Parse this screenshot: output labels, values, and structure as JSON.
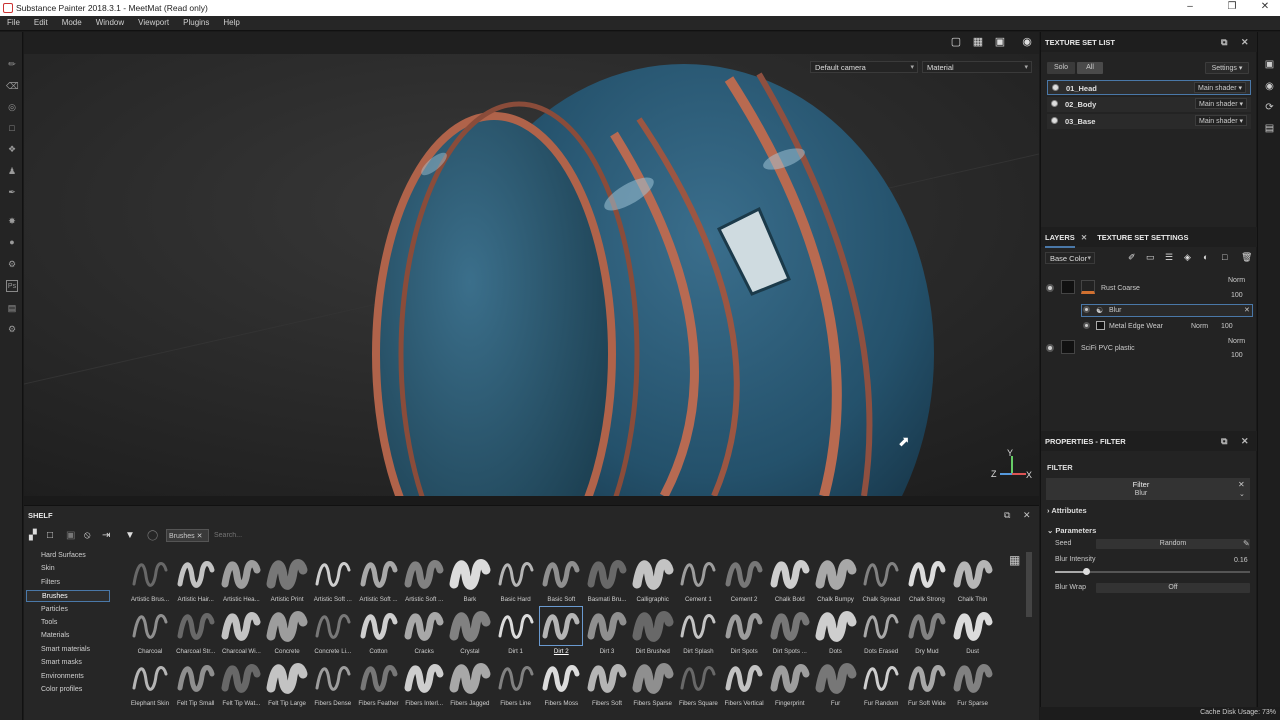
{
  "app": {
    "title": "Substance Painter 2018.3.1 - MeetMat (Read only)"
  },
  "menu": [
    "File",
    "Edit",
    "Mode",
    "Window",
    "Viewport",
    "Plugins",
    "Help"
  ],
  "viewport": {
    "camera": "Default camera",
    "mode": "Material",
    "gizmo": {
      "x": "X",
      "y": "Y",
      "z": "Z"
    }
  },
  "texture_set_list": {
    "title": "TEXTURE SET LIST",
    "solo": "Solo",
    "all": "All",
    "settings": "Settings",
    "sets": [
      {
        "name": "01_Head",
        "shader": "Main shader"
      },
      {
        "name": "02_Body",
        "shader": "Main shader"
      },
      {
        "name": "03_Base",
        "shader": "Main shader"
      }
    ]
  },
  "layers": {
    "tab_layers": "LAYERS",
    "tab_settings": "TEXTURE SET SETTINGS",
    "channel": "Base Color",
    "items": [
      {
        "name": "Rust Coarse",
        "blend": "Norm",
        "opacity": "100"
      },
      {
        "name": "Blur"
      },
      {
        "name": "Metal Edge Wear",
        "blend": "Norm",
        "opacity": "100"
      },
      {
        "name": "SciFi PVC plastic",
        "blend": "Norm",
        "opacity": "100"
      }
    ]
  },
  "properties": {
    "title": "PROPERTIES - FILTER",
    "section": "FILTER",
    "filter_label": "Filter",
    "filter_value": "Blur",
    "attributes": "Attributes",
    "parameters": "Parameters",
    "seed_label": "Seed",
    "seed_value": "Random",
    "blur_intensity_label": "Blur Intensity",
    "blur_intensity_value": "0.16",
    "blur_intensity_fraction": 0.16,
    "blur_wrap_label": "Blur Wrap",
    "blur_wrap_value": "Off"
  },
  "shelf": {
    "title": "SHELF",
    "filter_tag": "Brushes",
    "search_placeholder": "Search...",
    "categories": [
      "Hard Surfaces",
      "Skin",
      "Filters",
      "Brushes",
      "Particles",
      "Tools",
      "Materials",
      "Smart materials",
      "Smart masks",
      "Environments",
      "Color profiles"
    ],
    "selected_category": "Brushes",
    "brushes_row1": [
      "Artistic Brus...",
      "Artistic Hair...",
      "Artistic Hea...",
      "Artistic Print",
      "Artistic Soft ...",
      "Artistic Soft ...",
      "Artistic Soft ...",
      "Bark",
      "Basic Hard",
      "Basic Soft",
      "Basmati Bru...",
      "Calligraphic",
      "Cement 1",
      "Cement 2",
      "Chalk Bold",
      "Chalk Bumpy",
      "Chalk Spread",
      "Chalk Strong",
      "Chalk Thin"
    ],
    "brushes_row2": [
      "Charcoal",
      "Charcoal Str...",
      "Charcoal Wi...",
      "Concrete",
      "Concrete Li...",
      "Cotton",
      "Cracks",
      "Crystal",
      "Dirt 1",
      "Dirt 2",
      "Dirt 3",
      "Dirt Brushed",
      "Dirt Splash",
      "Dirt Spots",
      "Dirt Spots ...",
      "Dots",
      "Dots Erased",
      "Dry Mud",
      "Dust"
    ],
    "brushes_row3": [
      "Elephant Skin",
      "Felt Tip Small",
      "Felt Tip Wat...",
      "Felt Tip Large",
      "Fibers Dense",
      "Fibers Feather",
      "Fibers Interl...",
      "Fibers Jagged",
      "Fibers Line",
      "Fibers Moss",
      "Fibers Soft",
      "Fibers Sparse",
      "Fibers Square",
      "Fibers Vertical",
      "Fingerprint",
      "Fur",
      "Fur Random",
      "Fur Soft Wide",
      "Fur Sparse"
    ],
    "selected_brush": "Dirt 2"
  },
  "status": {
    "cache": "Cache Disk Usage:",
    "cache_value": "73%"
  }
}
